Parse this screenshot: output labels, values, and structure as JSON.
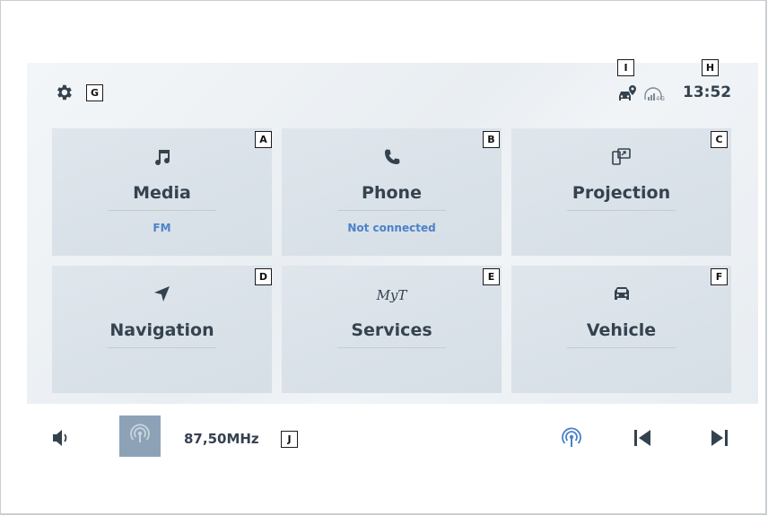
{
  "header": {
    "time": "13:52",
    "settings_icon": "gear-icon",
    "status_icons": [
      "car-location-icon",
      "signal-4g-icon"
    ],
    "label_G": "G",
    "label_I": "I",
    "label_H": "H"
  },
  "tiles": [
    {
      "title": "Media",
      "subtitle": "FM",
      "icon": "music-note-icon",
      "label": "A"
    },
    {
      "title": "Phone",
      "subtitle": "Not connected",
      "icon": "phone-icon",
      "label": "B"
    },
    {
      "title": "Projection",
      "subtitle": "",
      "icon": "projection-icon",
      "label": "C"
    },
    {
      "title": "Navigation",
      "subtitle": "",
      "icon": "navigation-arrow-icon",
      "label": "D"
    },
    {
      "title": "Services",
      "subtitle": "",
      "icon": "myt-logo-icon",
      "label": "E",
      "logo_text": "MyT"
    },
    {
      "title": "Vehicle",
      "subtitle": "",
      "icon": "car-icon",
      "label": "F"
    }
  ],
  "bottom_bar": {
    "frequency": "87,50MHz",
    "label_J": "J",
    "icons": [
      "volume-icon",
      "radio-source-icon",
      "radio-antenna-icon",
      "previous-track-icon",
      "next-track-icon"
    ]
  },
  "colors": {
    "accent_blue": "#4b82c8",
    "tile_bg": "#d9e1e8",
    "radio_button_bg": "#8da2b6",
    "text_dark": "#35424f"
  }
}
